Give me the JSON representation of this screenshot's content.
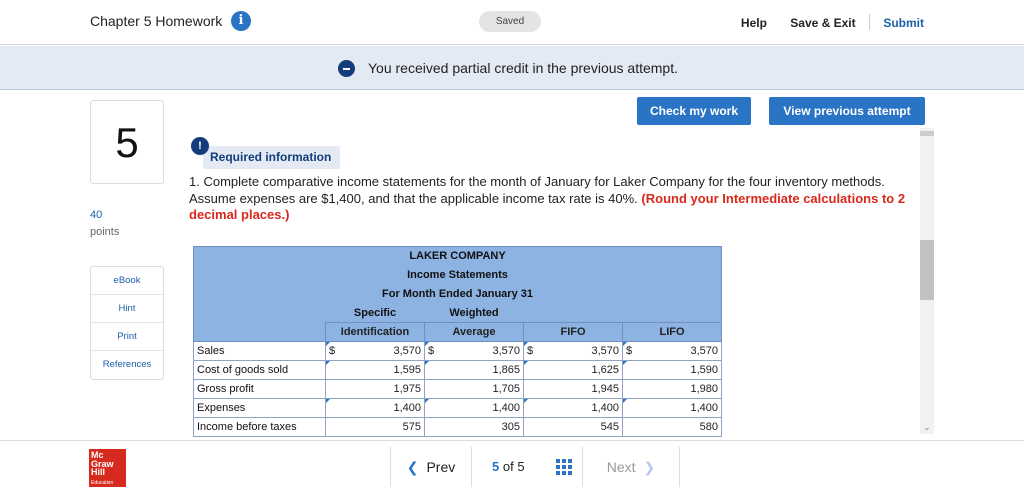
{
  "header": {
    "title": "Chapter 5 Homework",
    "saved": "Saved",
    "help": "Help",
    "save_exit": "Save & Exit",
    "submit": "Submit"
  },
  "banner": {
    "message": "You received partial credit in the previous attempt."
  },
  "actions": {
    "check": "Check my work",
    "previous": "View previous attempt"
  },
  "question": {
    "number": "5",
    "points_value": "40",
    "points_label": "points",
    "required_label": "Required information",
    "text": "1. Complete comparative income statements for the month of January for Laker Company for the four inventory methods. Assume expenses are $1,400, and that the applicable income tax rate is 40%.",
    "emphasis": "(Round your Intermediate calculations to 2 decimal places.)"
  },
  "sidebar": [
    "eBook",
    "Hint",
    "Print",
    "References"
  ],
  "table": {
    "company": "LAKER COMPANY",
    "statement": "Income Statements",
    "period": "For Month Ended January 31",
    "col_top": [
      "Specific",
      "Weighted",
      "",
      ""
    ],
    "col_bottom": [
      "Identification",
      "Average",
      "FIFO",
      "LIFO"
    ],
    "rows": [
      {
        "label": "Sales",
        "dollar": "$",
        "values": [
          "3,570",
          "3,570",
          "3,570",
          "3,570"
        ]
      },
      {
        "label": "Cost of goods sold",
        "dollar": "",
        "values": [
          "1,595",
          "1,865",
          "1,625",
          "1,590"
        ]
      },
      {
        "label": "Gross profit",
        "dollar": "",
        "values": [
          "1,975",
          "1,705",
          "1,945",
          "1,980"
        ]
      },
      {
        "label": "Expenses",
        "dollar": "",
        "values": [
          "1,400",
          "1,400",
          "1,400",
          "1,400"
        ]
      },
      {
        "label": "Income before taxes",
        "dollar": "",
        "values": [
          "575",
          "305",
          "545",
          "580"
        ]
      }
    ]
  },
  "footer": {
    "prev": "Prev",
    "current": "5",
    "of": "of",
    "total": "5",
    "next": "Next",
    "logo_lines": [
      "Mc",
      "Graw",
      "Hill",
      "Education"
    ]
  },
  "colors": {
    "accent": "#2a74c6",
    "dark": "#123d7a",
    "alert": "#d9291c",
    "table_header": "#8db3e2"
  }
}
